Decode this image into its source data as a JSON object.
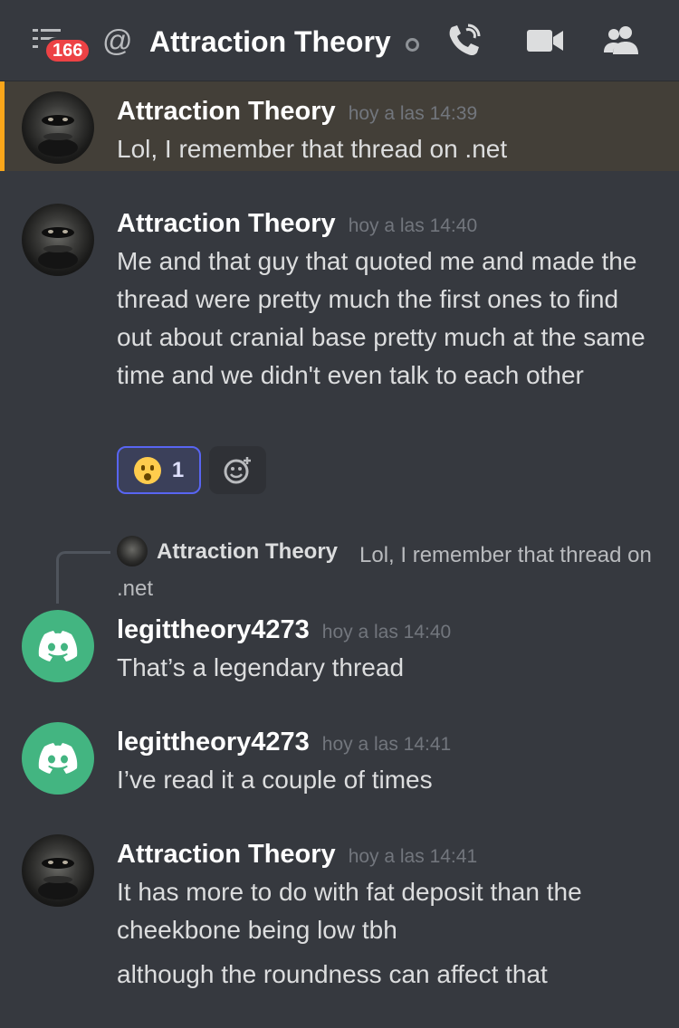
{
  "header": {
    "unread_badge": "166",
    "at_symbol": "@",
    "channel_title": "Attraction Theory",
    "icons": [
      "menu-icon",
      "at-icon",
      "status-dot-icon",
      "voice-call-icon",
      "video-call-icon",
      "members-icon"
    ]
  },
  "messages": [
    {
      "username": "Attraction Theory",
      "timestamp": "hoy a las 14:39",
      "lines": [
        "Lol, I remember that thread on .net"
      ],
      "highlighted": true
    },
    {
      "username": "Attraction Theory",
      "timestamp": "hoy a las 14:40",
      "text": "Me and that guy that quoted me and made the thread were pretty much the first ones to find out about cranial base pretty much at the same time and we didn't even talk to each other",
      "reaction": {
        "emoji": "hushed-face",
        "count": "1"
      }
    },
    {
      "reply_to": {
        "username": "Attraction Theory",
        "text": "Lol, I remember that thread on .net"
      },
      "username": "legittheory4273",
      "timestamp": "hoy a las 14:40",
      "text": "That’s a legendary thread"
    },
    {
      "username": "legittheory4273",
      "timestamp": "hoy a las 14:41",
      "text": "I’ve read it a couple of times"
    },
    {
      "username": "Attraction Theory",
      "timestamp": "hoy a las 14:41",
      "text": "It has more to do with fat deposit than the cheekbone being low tbh",
      "followup": "although the roundness can affect that"
    }
  ],
  "colors": {
    "background": "#36393f",
    "highlight_bg": "#433f38",
    "highlight_bar": "#faa61a",
    "badge": "#ed4245",
    "discord_avatar": "#43b581",
    "reaction_border": "#5865f2"
  }
}
